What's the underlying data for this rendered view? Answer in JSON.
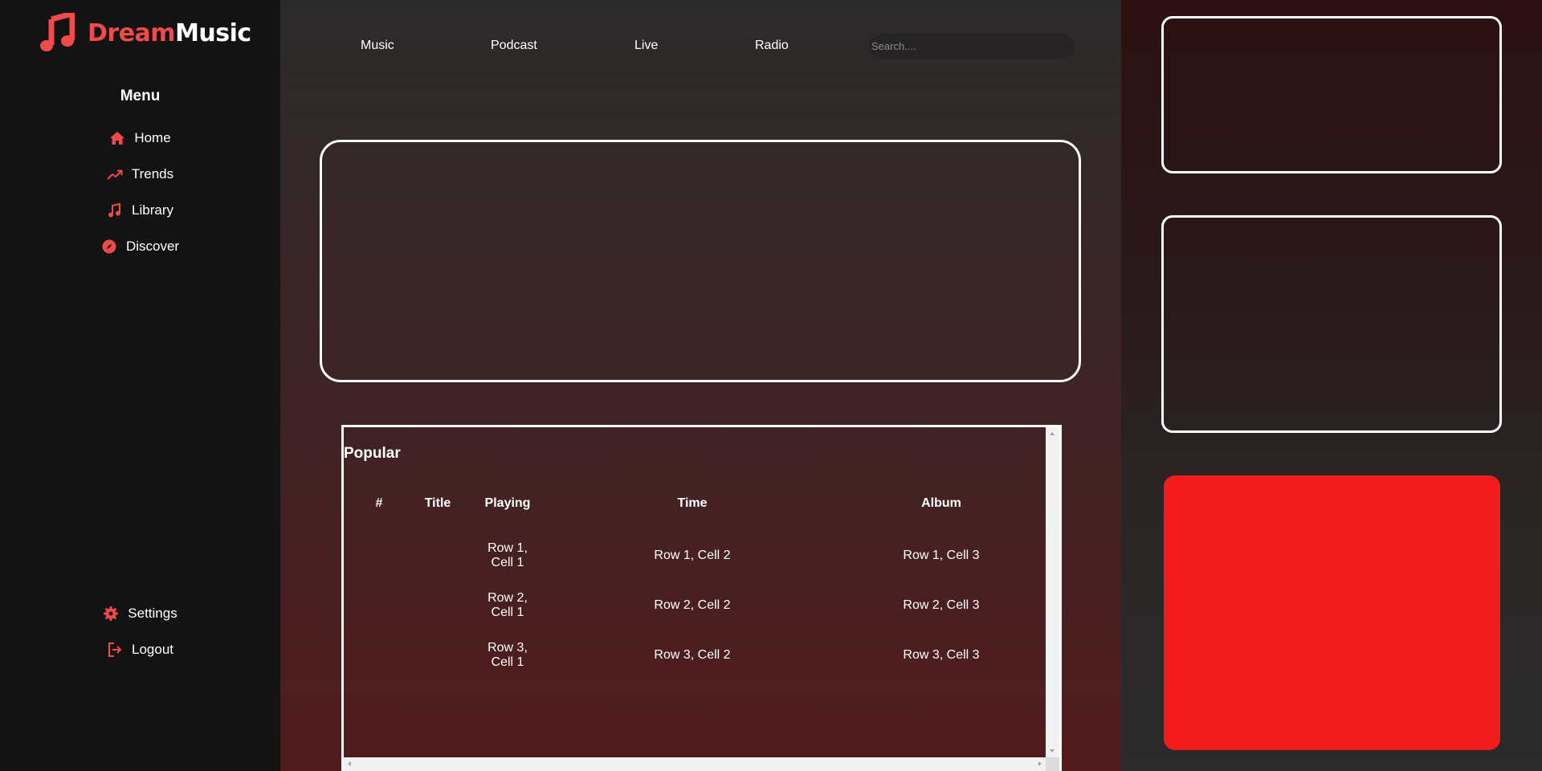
{
  "brand": {
    "name_accent": "Dream",
    "name_rest": "Music",
    "accent_color": "#f04a4a",
    "icon": "music-note-icon"
  },
  "sidebar": {
    "menu_title": "Menu",
    "items": [
      {
        "label": "Home",
        "icon": "home-icon"
      },
      {
        "label": "Trends",
        "icon": "trending-up-icon"
      },
      {
        "label": "Library",
        "icon": "music-library-icon"
      },
      {
        "label": "Discover",
        "icon": "compass-icon"
      }
    ],
    "bottom_items": [
      {
        "label": "Settings",
        "icon": "gear-icon"
      },
      {
        "label": "Logout",
        "icon": "logout-icon"
      }
    ]
  },
  "topnav": {
    "items": [
      "Music",
      "Podcast",
      "Live",
      "Radio"
    ],
    "search_placeholder": "Search...."
  },
  "popular": {
    "title": "Popular",
    "columns": [
      "#",
      "Title",
      "Playing",
      "Time",
      "Album"
    ],
    "rows": [
      {
        "playing_line1": "Row 1,",
        "playing_line2": "Cell 1",
        "time": "Row 1, Cell 2",
        "album": "Row 1, Cell 3"
      },
      {
        "playing_line1": "Row 2,",
        "playing_line2": "Cell 1",
        "time": "Row 2, Cell 2",
        "album": "Row 2, Cell 3"
      },
      {
        "playing_line1": "Row 3,",
        "playing_line2": "Cell 1",
        "time": "Row 3, Cell 2",
        "album": "Row 3, Cell 3"
      }
    ]
  },
  "colors": {
    "sidebar_bg": "#131313",
    "player_bg": "#f21c1c",
    "icon_accent": "#f04a4a"
  }
}
